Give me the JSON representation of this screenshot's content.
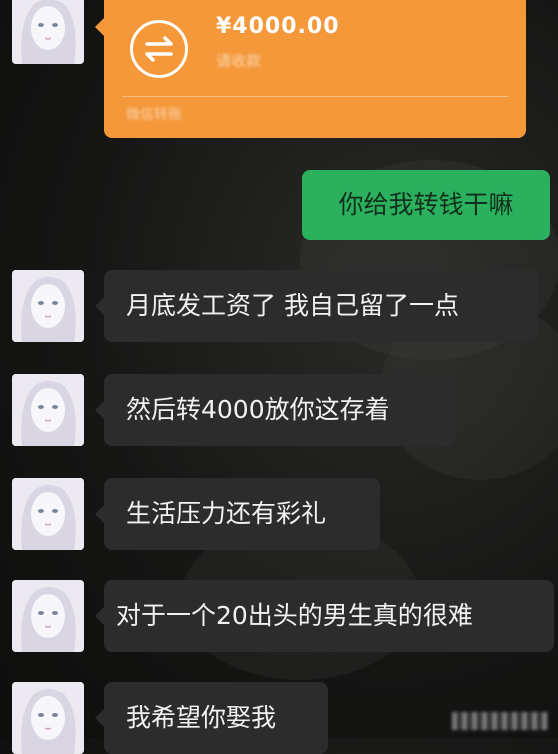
{
  "conversation": {
    "transfer": {
      "amount": "¥4000.00",
      "status": "请收款",
      "footer": "微信转账"
    },
    "sent_message": "你给我转钱干嘛",
    "received_messages": [
      "月底发工资了 我自己留了一点",
      "然后转4000放你这存着",
      "生活压力还有彩礼",
      "对于一个20出头的男生真的很难",
      "我希望你娶我"
    ]
  },
  "colors": {
    "transfer_bubble": "#f5983a",
    "sent_bubble": "#2bb15e",
    "received_bubble": "#2c2c2c",
    "background": "#161615"
  }
}
